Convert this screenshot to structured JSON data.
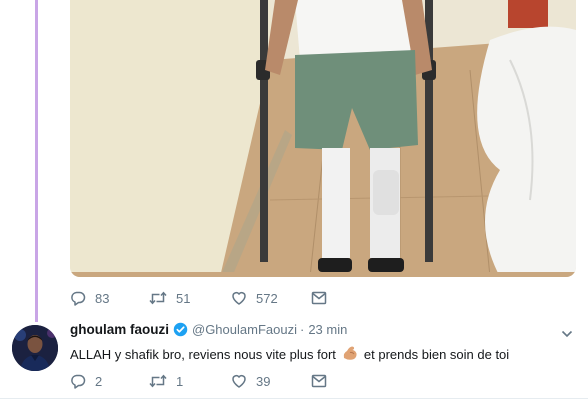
{
  "tweet1": {
    "image_alt": "Photo of a man on crutches in a hospital room",
    "actions": {
      "replies": "83",
      "retweets": "51",
      "likes": "572"
    }
  },
  "tweet2": {
    "display_name": "ghoulam faouzi",
    "handle": "@GhoulamFaouzi",
    "separator": "·",
    "time": "23 min",
    "text_before": "ALLAH y shafik bro, reviens nous vite plus fort",
    "text_after": "et prends bien soin de toi",
    "emoji": "flexed-biceps-emoji",
    "actions": {
      "replies": "2",
      "retweets": "1",
      "likes": "39"
    }
  },
  "colors": {
    "thread_line": "#c9a5e6",
    "muted": "#657786",
    "verified": "#1da1f2"
  }
}
